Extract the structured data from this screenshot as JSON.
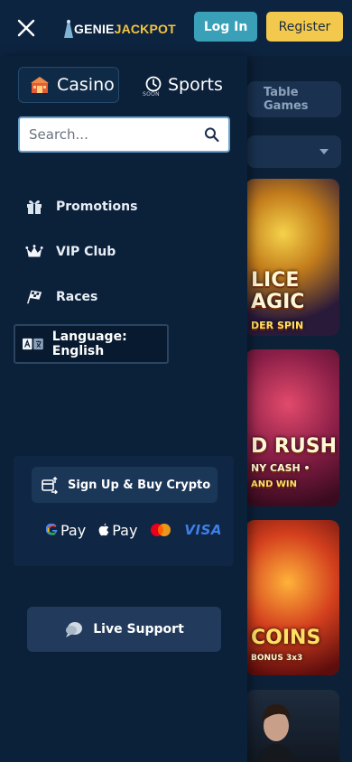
{
  "header": {
    "logo_text_genie": "GENIE",
    "logo_text_jackpot": "JACKPOT",
    "login_label": "Log In",
    "register_label": "Register"
  },
  "background": {
    "tab_label": "Table Games",
    "tiles": [
      {
        "line1": "LICE",
        "line2": "AGIC",
        "line3": "DER SPIN"
      },
      {
        "line1": "D RUSH",
        "line2": "NY CASH •",
        "line3": "AND WIN"
      },
      {
        "line1": "COINS",
        "line2": "BONUS 3x3"
      }
    ]
  },
  "drawer": {
    "tabs": {
      "casino": "Casino",
      "sports": "Sports",
      "sports_badge": "SOON"
    },
    "search": {
      "placeholder": "Search..."
    },
    "menu": [
      {
        "label": "Promotions",
        "icon": "gift-icon"
      },
      {
        "label": "VIP Club",
        "icon": "crown-icon"
      },
      {
        "label": "Races",
        "icon": "checkered-flag-icon"
      }
    ],
    "language_label": "Language: English",
    "crypto": {
      "button_label": "Sign Up & Buy Crypto",
      "gpay_label": "Pay",
      "applepay_label": "Pay",
      "visa_label": "VISA"
    },
    "support_label": "Live Support"
  },
  "colors": {
    "accent_login": "#3aa0b8",
    "accent_register": "#f2c94c",
    "drawer_bg": "#0b2039"
  }
}
